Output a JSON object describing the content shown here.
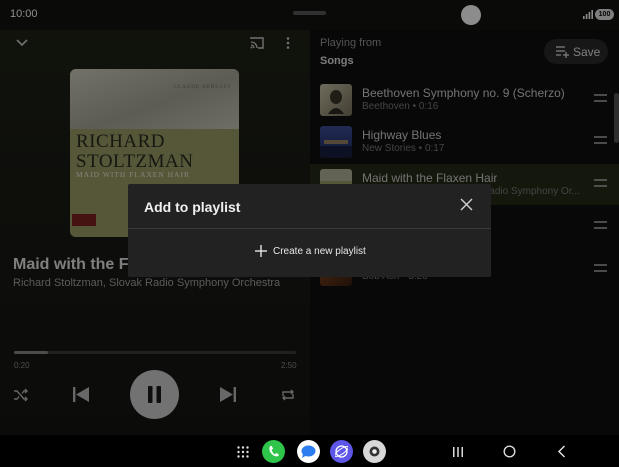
{
  "status_bar": {
    "time": "10:00",
    "battery": "100"
  },
  "player": {
    "album_art": {
      "composer": "CLAUDE DEBUSSY",
      "artist_line1": "RICHARD",
      "artist_line2": "STOLTZMAN",
      "subtitle": "MAID WITH FLAXEN HAIR"
    },
    "track_title": "Maid with the Flaxen Hair",
    "track_artist": "Richard Stoltzman, Slovak Radio Symphony Orchestra",
    "progress_fraction": 0.12,
    "time_elapsed": "0:20",
    "time_total": "2:50"
  },
  "queue": {
    "playing_from_label": "Playing from",
    "source": "Songs",
    "save_label": "Save",
    "items": [
      {
        "title": "Beethoven Symphony no. 9 (Scherzo)",
        "subtitle": "Beethoven • 0:16"
      },
      {
        "title": "Highway Blues",
        "subtitle": "New Stories • 0:17"
      },
      {
        "title": "Maid with the Flaxen Hair",
        "subtitle": "Richard Stoltzman, Slovak Radio Symphony Or..."
      },
      {
        "title": "",
        "subtitle": ""
      },
      {
        "title": "",
        "subtitle": "Bob Acri • 3:20"
      }
    ]
  },
  "dialog": {
    "title": "Add to playlist",
    "create_label": "Create a new playlist"
  },
  "colors": {
    "active_row": "#262a16",
    "dialog_bg": "#222222",
    "phone_app": "#2fc44a",
    "internet_app": "#5d56e8"
  }
}
